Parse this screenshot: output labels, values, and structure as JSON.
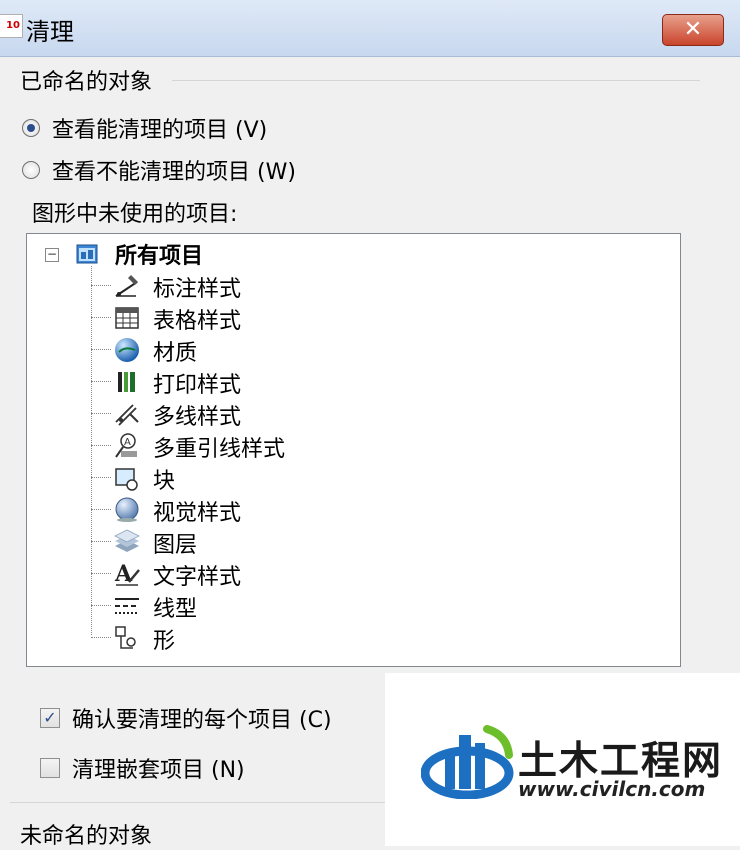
{
  "window": {
    "app_icon_text": "10",
    "title": "清理",
    "close_symbol": "✕"
  },
  "named_objects": {
    "group_title": "已命名的对象",
    "radio_options": [
      {
        "label": "查看能清理的项目 (V)",
        "checked": true
      },
      {
        "label": "查看不能清理的项目 (W)",
        "checked": false
      }
    ],
    "unused_label": "图形中未使用的项目:"
  },
  "tree": {
    "expander_symbol": "−",
    "root_label": "所有项目",
    "root_icon": "drawing-icon",
    "items": [
      {
        "label": "标注样式",
        "icon": "dimension-style-icon"
      },
      {
        "label": "表格样式",
        "icon": "table-style-icon"
      },
      {
        "label": "材质",
        "icon": "material-globe-icon"
      },
      {
        "label": "打印样式",
        "icon": "plot-style-icon"
      },
      {
        "label": "多线样式",
        "icon": "multiline-style-icon"
      },
      {
        "label": "多重引线样式",
        "icon": "multileader-style-icon"
      },
      {
        "label": "块",
        "icon": "block-icon"
      },
      {
        "label": "视觉样式",
        "icon": "visual-style-icon"
      },
      {
        "label": "图层",
        "icon": "layer-icon"
      },
      {
        "label": "文字样式",
        "icon": "text-style-icon"
      },
      {
        "label": "线型",
        "icon": "linetype-icon"
      },
      {
        "label": "形",
        "icon": "shape-icon"
      }
    ]
  },
  "options": {
    "confirm_each": {
      "label": "确认要清理的每个项目 (C)",
      "checked": true,
      "check_symbol": "✓"
    },
    "purge_nested": {
      "label": "清理嵌套项目 (N)",
      "checked": false
    }
  },
  "unnamed_objects": {
    "group_title": "未命名的对象"
  },
  "watermark": {
    "name": "土木工程网",
    "url": "www.civilcn.com"
  },
  "colors": {
    "accent": "#2c4d8c",
    "close_button": "#c9442c",
    "logo_blue": "#1d6fc2",
    "logo_green": "#6cbf2a"
  }
}
